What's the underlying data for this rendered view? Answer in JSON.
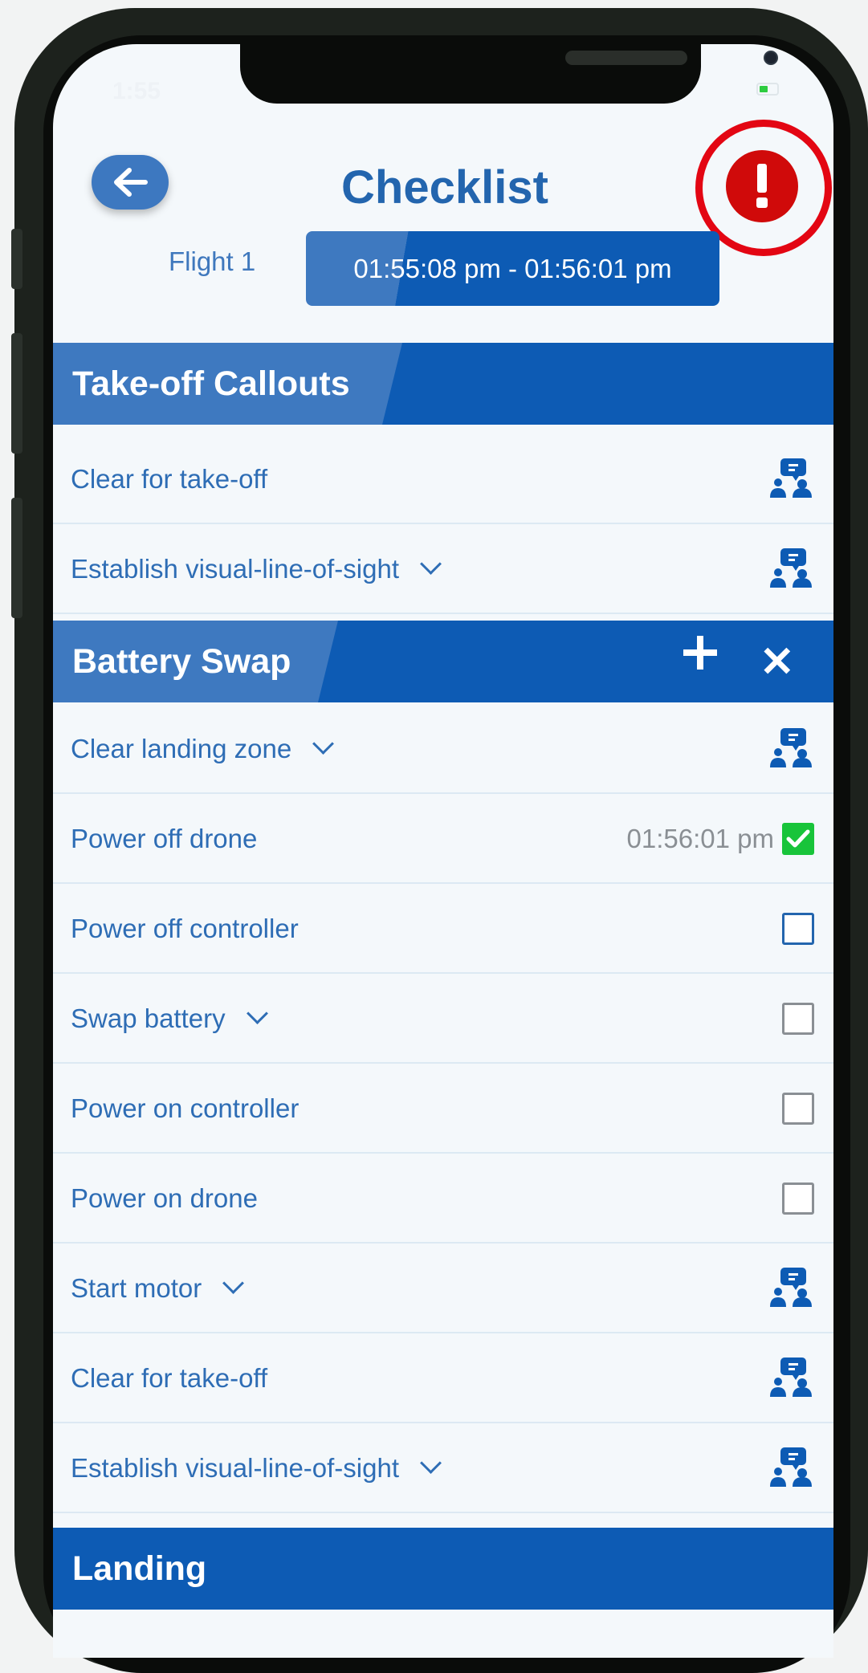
{
  "status": {
    "time": "1:55"
  },
  "header": {
    "title": "Checklist",
    "flight_label": "Flight 1",
    "flight_time": "01:55:08 pm - 01:56:01 pm"
  },
  "sections": [
    {
      "label": "Take-off Callouts"
    },
    {
      "label": "Battery Swap"
    },
    {
      "label": "Landing"
    }
  ],
  "items": [
    {
      "label": "Clear for take-off",
      "control": "callout-icon"
    },
    {
      "label": "Establish visual-line-of-sight",
      "control": "callout-icon"
    },
    {
      "label": "Clear landing zone",
      "control": "callout-icon"
    },
    {
      "label": "Power off drone",
      "time": "01:56:01 pm",
      "control": "checked-box"
    },
    {
      "label": "Power off controller",
      "control": "checkbox"
    },
    {
      "label": "Swap battery",
      "control": "checkbox"
    },
    {
      "label": "Power on controller",
      "control": "checkbox"
    },
    {
      "label": "Power on drone",
      "control": "checkbox"
    },
    {
      "label": "Start motor",
      "control": "callout-icon"
    },
    {
      "label": "Clear for take-off",
      "control": "callout-icon"
    },
    {
      "label": "Establish visual-line-of-sight",
      "control": "callout-icon"
    }
  ],
  "colors": {
    "primary": "#0d5bb4",
    "accent": "#3e79c0",
    "alert": "#d00a0a",
    "check": "#18c43a"
  }
}
